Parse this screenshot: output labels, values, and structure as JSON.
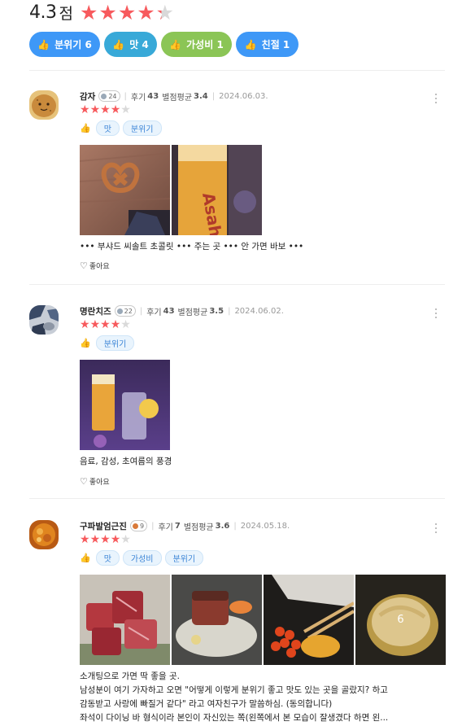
{
  "summary": {
    "score": "4.3",
    "unit": "점",
    "rating": 4.3
  },
  "chips": [
    {
      "label": "분위기 6",
      "icon": "thumbs-up-icon"
    },
    {
      "label": "맛 4",
      "icon": "thumbs-up-icon"
    },
    {
      "label": "가성비 1",
      "icon": "thumbs-up-icon"
    },
    {
      "label": "친절 1",
      "icon": "thumbs-up-icon"
    }
  ],
  "colors": {
    "star": "#f75a5d",
    "chip_blue": "#3e98f7",
    "chip_teal": "#38a9d8",
    "chip_green": "#8bc556"
  },
  "reviews": [
    {
      "name": "감자",
      "level": "24",
      "reviews_label": "후기",
      "reviews_count": "43",
      "avg_label": "별점평균",
      "avg": "3.4",
      "date": "2024.06.03.",
      "rating": 4,
      "tags": [
        "맛",
        "분위기"
      ],
      "text": "••• 부샤드 씨솔트 초콜릿 ••• 주는 곳 ••• 안 가면 바보 •••",
      "like_label": "좋아요"
    },
    {
      "name": "명란치즈",
      "level": "22",
      "reviews_label": "후기",
      "reviews_count": "43",
      "avg_label": "별점평균",
      "avg": "3.5",
      "date": "2024.06.02.",
      "rating": 4,
      "tags": [
        "분위기"
      ],
      "text": "음료, 감성, 초여름의 풍경",
      "like_label": "좋아요"
    },
    {
      "name": "구파발엄근진",
      "level": "9",
      "reviews_label": "후기",
      "reviews_count": "7",
      "avg_label": "별점평균",
      "avg": "3.6",
      "date": "2024.05.18.",
      "rating": 4,
      "tags": [
        "맛",
        "가성비",
        "분위기"
      ],
      "photo_more_count": "6",
      "text_lines": [
        "소개팅으로 가면 딱 좋을 곳.",
        "남성분이 여기 가자하고 오면 \"어떻게 이렇게 분위기 좋고 맛도 있는 곳을 골랐지? 하고",
        "감동받고 사랑에 빠질거 같다\" 라고 여자친구가 말씀하심. (동의합니다)",
        "좌석이 다이닝 바 형식이라 본인이 자신있는 쪽(왼쪽에서 본 모습이 잘생겼다 하면 왼..."
      ]
    }
  ]
}
